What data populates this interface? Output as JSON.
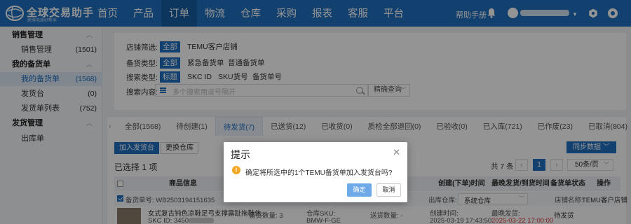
{
  "brand": {
    "name": "全球交易助手",
    "slogan": "跨境电商好帮手",
    "color": "#1f6fbf"
  },
  "nav": {
    "items": [
      "首页",
      "产品",
      "订单",
      "物流",
      "仓库",
      "采购",
      "报表",
      "客服",
      "平台"
    ],
    "active": "订单"
  },
  "top_right": {
    "help": "帮助手册",
    "icons": [
      "bell-icon",
      "user-icon",
      "settings-icon",
      "power-icon"
    ]
  },
  "sidebar": {
    "groups": [
      {
        "label": "销售管理",
        "items": [
          {
            "label": "销售管理",
            "count": "(1501)"
          }
        ]
      },
      {
        "label": "我的备货单",
        "items": [
          {
            "label": "我的备货单",
            "count": "(1568)",
            "active": true
          },
          {
            "label": "发货台",
            "count": "(0)"
          },
          {
            "label": "发货单列表",
            "count": "(752)"
          }
        ]
      },
      {
        "label": "发货管理",
        "items": [
          {
            "label": "出库单",
            "count": ""
          }
        ]
      }
    ]
  },
  "filters": {
    "shop": {
      "label": "店铺筛选:",
      "options": [
        "全部",
        "TEMU客户店铺"
      ]
    },
    "stock_type": {
      "label": "备货类型:",
      "options": [
        "全部",
        "紧急备货单",
        "普通备货单"
      ]
    },
    "search_type": {
      "label": "搜索类型:",
      "options": [
        "标题",
        "SKC ID",
        "SKU货号",
        "备货单号"
      ]
    },
    "search_content": {
      "label": "搜索内容:",
      "placeholder": "多个搜索用逗号隔开",
      "match_mode": "精确查询"
    }
  },
  "tabs": [
    {
      "label": "全部(1568)"
    },
    {
      "label": "待创建(1)"
    },
    {
      "label": "待发货(7)",
      "active": true
    },
    {
      "label": "已送货(12)"
    },
    {
      "label": "已收货(0)"
    },
    {
      "label": "质检全部退回(0)"
    },
    {
      "label": "已验收(0)"
    },
    {
      "label": "已入库(721)"
    },
    {
      "label": "已作废(23)"
    },
    {
      "label": "已取消(804)"
    }
  ],
  "toolbar": {
    "add_to_shipping": "加入发货台",
    "change_warehouse": "更换仓库",
    "sync_data": "同步数据",
    "selected_text": "已选择 1 项"
  },
  "pager": {
    "total": "共 7 条",
    "current": "1",
    "per_page": "50条/页"
  },
  "table": {
    "headers": [
      "商品信息",
      "量",
      "创建(下单)时间",
      "最晚发货/到货时间",
      "备货单状态",
      "操作"
    ],
    "row": {
      "order_no": "备货单号: WB2503194151635",
      "warehouse_label": "出库仓库:",
      "warehouse_value": "系统仓库",
      "shop_label": "店铺名称:",
      "shop_value": "TEMU客户店铺",
      "title": "女式复古钝色凉鞋足弓支撑露趾拖鞋休...",
      "skc": "SKC ID: 3450",
      "stock_qty": "备货数量: 3",
      "warehouse_sku": "仓库SKU:",
      "sku_code": "BMW-F-GE",
      "delivered_qty": "送货数量: -",
      "created_label": "创建时间:",
      "created_value": "2025-03-19 17:43:50",
      "latest_label": "最晚发货:",
      "latest_value": "2025-03-22 17:00:00",
      "status": "待发货"
    }
  },
  "dialog": {
    "title": "提示",
    "message": "确定将所选中的1个TEMU备货单加入发货台吗?",
    "ok": "确定",
    "cancel": "取消"
  }
}
